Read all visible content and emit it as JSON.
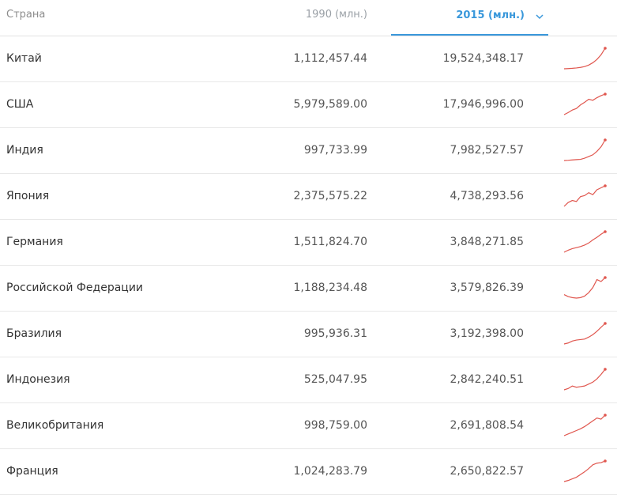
{
  "header": {
    "country": "Страна",
    "col_1990": "1990 (млн.)",
    "col_2015": "2015 (млн.)",
    "sort_icon": "chevron-down-icon"
  },
  "accent_color": "#3a98db",
  "sparkline_color": "#e0574f",
  "rows": [
    {
      "name": "Китай",
      "v1990": "1,112,457.44",
      "v2015": "19,524,348.17",
      "trend": [
        1,
        1.02,
        1.05,
        1.09,
        1.15,
        1.24,
        1.4,
        1.65,
        2.0,
        2.5,
        3.2
      ]
    },
    {
      "name": "США",
      "v1990": "5,979,589.00",
      "v2015": "17,946,996.00",
      "trend": [
        1,
        1.2,
        1.45,
        1.6,
        1.95,
        2.2,
        2.5,
        2.4,
        2.65,
        2.85,
        3.0
      ]
    },
    {
      "name": "Индия",
      "v1990": "997,733.99",
      "v2015": "7,982,527.57",
      "trend": [
        1,
        1.02,
        1.05,
        1.08,
        1.1,
        1.2,
        1.35,
        1.5,
        1.8,
        2.2,
        2.8
      ]
    },
    {
      "name": "Япония",
      "v1990": "2,375,575.22",
      "v2015": "4,738,293.56",
      "trend": [
        1,
        1.4,
        1.6,
        1.5,
        2.0,
        2.1,
        2.4,
        2.2,
        2.7,
        2.9,
        3.1
      ]
    },
    {
      "name": "Германия",
      "v1990": "1,511,824.70",
      "v2015": "3,848,271.85",
      "trend": [
        1,
        1.2,
        1.35,
        1.45,
        1.55,
        1.7,
        1.9,
        2.2,
        2.45,
        2.75,
        3.0
      ]
    },
    {
      "name": "Российской Федерации",
      "v1990": "1,188,234.48",
      "v2015": "3,579,826.39",
      "trend": [
        1.4,
        1.2,
        1.1,
        1.05,
        1.1,
        1.25,
        1.6,
        2.1,
        2.9,
        2.7,
        3.1
      ]
    },
    {
      "name": "Бразилия",
      "v1990": "995,936.31",
      "v2015": "3,192,398.00",
      "trend": [
        1,
        1.1,
        1.3,
        1.4,
        1.45,
        1.5,
        1.7,
        1.95,
        2.3,
        2.7,
        3.1
      ]
    },
    {
      "name": "Индонезия",
      "v1990": "525,047.95",
      "v2015": "2,842,240.51",
      "trend": [
        1,
        1.1,
        1.3,
        1.2,
        1.25,
        1.3,
        1.45,
        1.6,
        1.85,
        2.2,
        2.6
      ]
    },
    {
      "name": "Великобритания",
      "v1990": "998,759.00",
      "v2015": "2,691,808.54",
      "trend": [
        1,
        1.15,
        1.3,
        1.45,
        1.6,
        1.8,
        2.05,
        2.3,
        2.55,
        2.45,
        2.8
      ]
    },
    {
      "name": "Франция",
      "v1990": "1,024,283.79",
      "v2015": "2,650,822.57",
      "trend": [
        1,
        1.1,
        1.25,
        1.4,
        1.65,
        1.9,
        2.2,
        2.55,
        2.7,
        2.75,
        2.9
      ]
    }
  ]
}
